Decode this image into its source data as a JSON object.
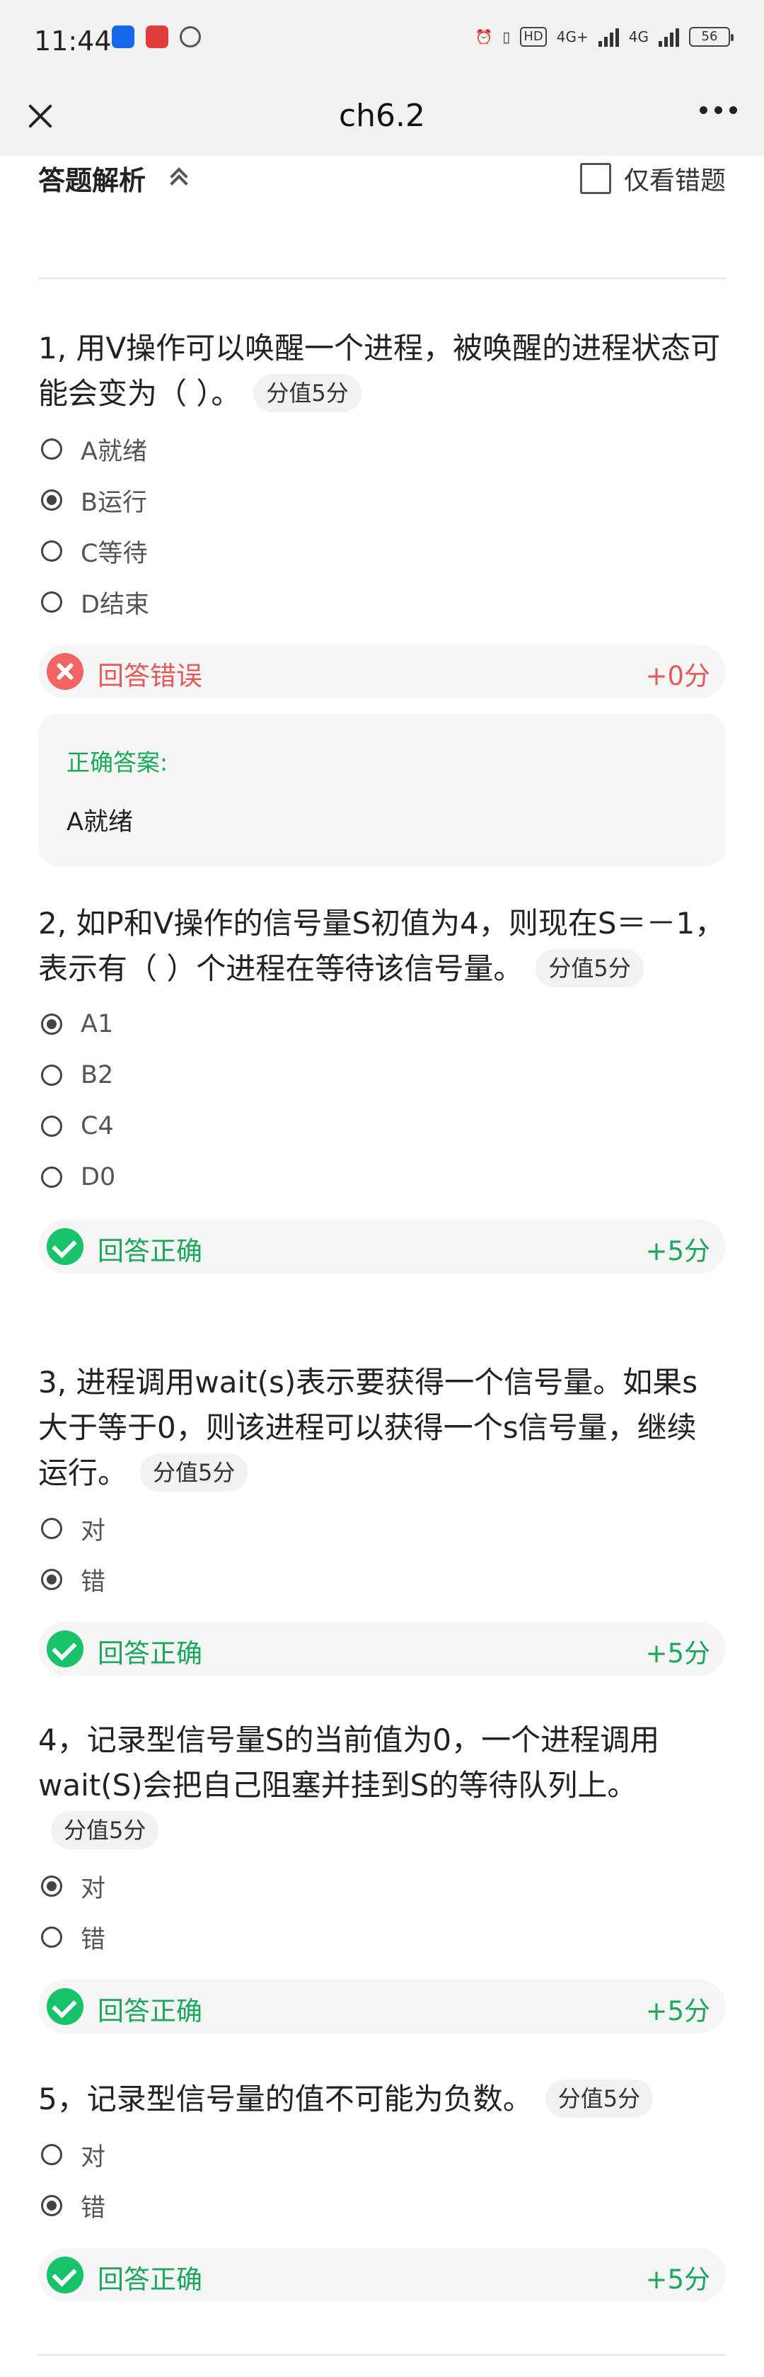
{
  "status_bar": {
    "time": "11:44",
    "hd_label": "HD",
    "network1": "4G+",
    "network2": "4G",
    "battery": "56"
  },
  "nav": {
    "title": "ch6.2",
    "close_icon": "close-icon",
    "more_icon": "more-icon"
  },
  "header": {
    "title": "答题解析",
    "wrong_only_label": "仅看错题"
  },
  "colors": {
    "correct": "#17c26a",
    "wrong": "#f36464"
  },
  "questions": [
    {
      "text": "1, 用V操作可以唤醒一个进程，被唤醒的进程状态可能会变为（ ）。",
      "score": "分值5分",
      "options": [
        "A就绪",
        "B运行",
        "C等待",
        "D结束"
      ],
      "selected": 1,
      "result": "回答错误",
      "points": "+0分",
      "correct": false,
      "answer_label": "正确答案:",
      "answer_value": "A就绪"
    },
    {
      "text": "2, 如P和V操作的信号量S初值为4，则现在S＝－1，表示有（ ）个进程在等待该信号量。",
      "score": "分值5分",
      "options": [
        "A1",
        "B2",
        "C4",
        "D0"
      ],
      "selected": 0,
      "result": "回答正确",
      "points": "+5分",
      "correct": true
    },
    {
      "text": "3, 进程调用wait(s)表示要获得一个信号量。如果s大于等于0，则该进程可以获得一个s信号量，继续运行。",
      "score": "分值5分",
      "options": [
        "对",
        "错"
      ],
      "selected": 1,
      "result": "回答正确",
      "points": "+5分",
      "correct": true
    },
    {
      "text": "4，记录型信号量S的当前值为0，一个进程调用wait(S)会把自己阻塞并挂到S的等待队列上。",
      "score": "分值5分",
      "options": [
        "对",
        "错"
      ],
      "selected": 0,
      "result": "回答正确",
      "points": "+5分",
      "correct": true
    },
    {
      "text": "5，记录型信号量的值不可能为负数。",
      "score": "分值5分",
      "options": [
        "对",
        "错"
      ],
      "selected": 1,
      "result": "回答正确",
      "points": "+5分",
      "correct": true
    }
  ]
}
